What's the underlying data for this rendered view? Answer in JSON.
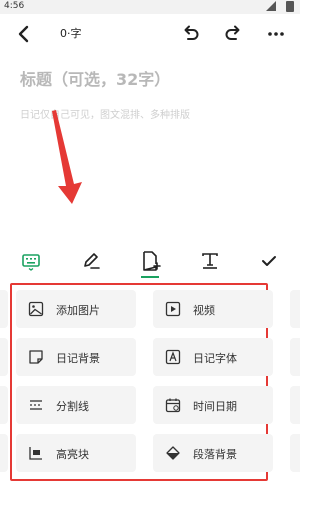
{
  "status": {
    "time": "4:56"
  },
  "header": {
    "word_count": "0·字"
  },
  "editor": {
    "title_placeholder": "标题（可选，32字）",
    "body_placeholder": "日记仅自己可见，图文混排、多种排版"
  },
  "toolbar": {
    "items": [
      {
        "icon": "keyboard-icon",
        "active": true
      },
      {
        "icon": "pen-icon"
      },
      {
        "icon": "insert-icon",
        "selected": true
      },
      {
        "icon": "text-format-icon"
      },
      {
        "icon": "check-icon"
      }
    ]
  },
  "insert_panel": {
    "items": [
      {
        "label": "添加图片",
        "icon": "image-icon"
      },
      {
        "label": "视频",
        "icon": "video-icon"
      },
      {
        "label": "日记背景",
        "icon": "note-background-icon"
      },
      {
        "label": "日记字体",
        "icon": "font-icon"
      },
      {
        "label": "分割线",
        "icon": "divider-icon"
      },
      {
        "label": "时间日期",
        "icon": "calendar-icon"
      },
      {
        "label": "高亮块",
        "icon": "highlight-block-icon"
      },
      {
        "label": "段落背景",
        "icon": "paragraph-background-icon"
      }
    ]
  },
  "colors": {
    "accent": "#1aa260",
    "annotation": "#e53935"
  }
}
